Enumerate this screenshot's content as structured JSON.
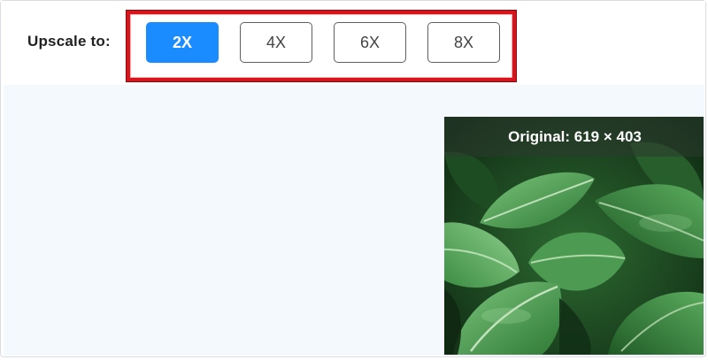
{
  "upscale": {
    "label": "Upscale to:",
    "options": [
      {
        "label": "2X",
        "selected": true
      },
      {
        "label": "4X",
        "selected": false
      },
      {
        "label": "6X",
        "selected": false
      },
      {
        "label": "8X",
        "selected": false
      }
    ]
  },
  "preview": {
    "caption": "Original: 619 × 403",
    "image_subject": "green-leaves-photo"
  },
  "colors": {
    "accent": "#1b8cff",
    "highlight": "#d8141c",
    "workspace_bg": "#f4f9fd"
  }
}
